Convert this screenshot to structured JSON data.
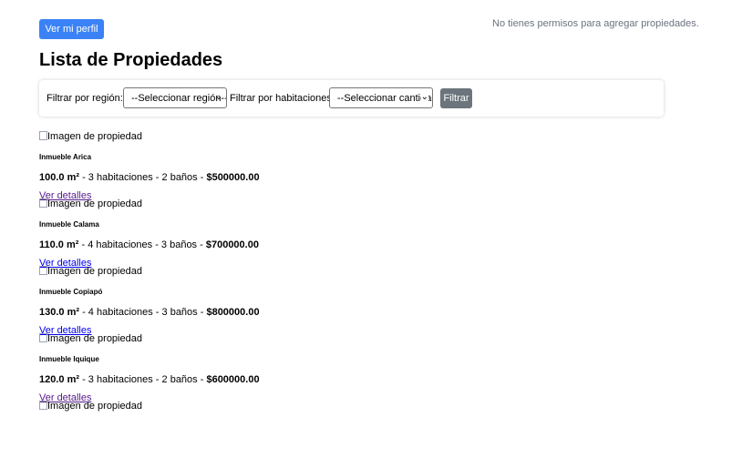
{
  "header": {
    "profile_button": "Ver mi perfil",
    "permission_message": "No tienes permisos para agregar propiedades."
  },
  "page_title": "Lista de Propiedades",
  "filters": {
    "region_label": "Filtrar por región:",
    "region_selected": "--Seleccionar región--",
    "rooms_label": "Filtrar por habitaciones:",
    "rooms_selected": "--Seleccionar cantidad--",
    "submit_label": "Filtrar"
  },
  "properties": [
    {
      "image_alt": "Imagen de propiedad",
      "name": "Inmueble Arica",
      "area": "100.0 m²",
      "details_text": " - 3 habitaciones - 2 baños - ",
      "price": "$500000.00",
      "link": "Ver detalles"
    },
    {
      "image_alt": "Imagen de propiedad",
      "name": "Inmueble Calama",
      "area": "110.0 m²",
      "details_text": " - 4 habitaciones - 3 baños - ",
      "price": "$700000.00",
      "link": "Ver detalles"
    },
    {
      "image_alt": "Imagen de propiedad",
      "name": "Inmueble Copiapó",
      "area": "130.0 m²",
      "details_text": " - 4 habitaciones - 3 baños - ",
      "price": "$800000.00",
      "link": "Ver detalles"
    },
    {
      "image_alt": "Imagen de propiedad",
      "name": "Inmueble Iquique",
      "area": "120.0 m²",
      "details_text": " - 3 habitaciones - 2 baños - ",
      "price": "$600000.00",
      "link": "Ver detalles"
    },
    {
      "image_alt": "Imagen de propiedad"
    }
  ],
  "colors": {
    "primary_button": "#3b82f6",
    "secondary_button": "#6c757d",
    "link_visited": "#551a8b",
    "link": "#0000ee"
  }
}
